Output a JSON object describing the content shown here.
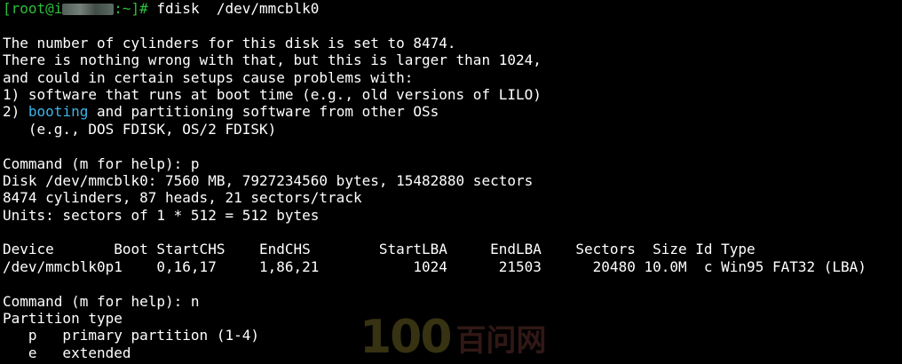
{
  "prompt": {
    "user": "[root@i",
    "suffix": ":~]# ",
    "command": "fdisk  /dev/mmcblk0"
  },
  "warning": {
    "line1": "The number of cylinders for this disk is set to 8474.",
    "line2": "There is nothing wrong with that, but this is larger than 1024,",
    "line3": "and could in certain setups cause problems with:",
    "line4": "1) software that runs at boot time (e.g., old versions of LILO)",
    "line5_prefix": "2) ",
    "line5_highlight": "booting",
    "line5_rest": " and partitioning software from other OSs",
    "line6": "   (e.g., DOS FDISK, OS/2 FDISK)"
  },
  "session1": {
    "command_line": "Command (m for help): p",
    "disk_line": "Disk /dev/mmcblk0: 7560 MB, 7927234560 bytes, 15482880 sectors",
    "geometry_line": "8474 cylinders, 87 heads, 21 sectors/track",
    "units_line": "Units: sectors of 1 * 512 = 512 bytes"
  },
  "partition_table": {
    "header": "Device       Boot StartCHS    EndCHS        StartLBA     EndLBA    Sectors  Size Id Type",
    "rows": [
      "/dev/mmcblk0p1    0,16,17     1,86,21           1024      21503      20480 10.0M  c Win95 FAT32 (LBA)"
    ]
  },
  "session2": {
    "command_line": "Command (m for help): n",
    "partition_type_label": "Partition type",
    "option_p": "   p   primary partition (1-4)",
    "option_e": "   e   extended"
  },
  "watermark": {
    "number": "100",
    "text": "百问网"
  },
  "colors": {
    "background": "#000000",
    "foreground": "#ffffff",
    "prompt": "#2dbf3a",
    "highlight": "#3bb4e6"
  }
}
